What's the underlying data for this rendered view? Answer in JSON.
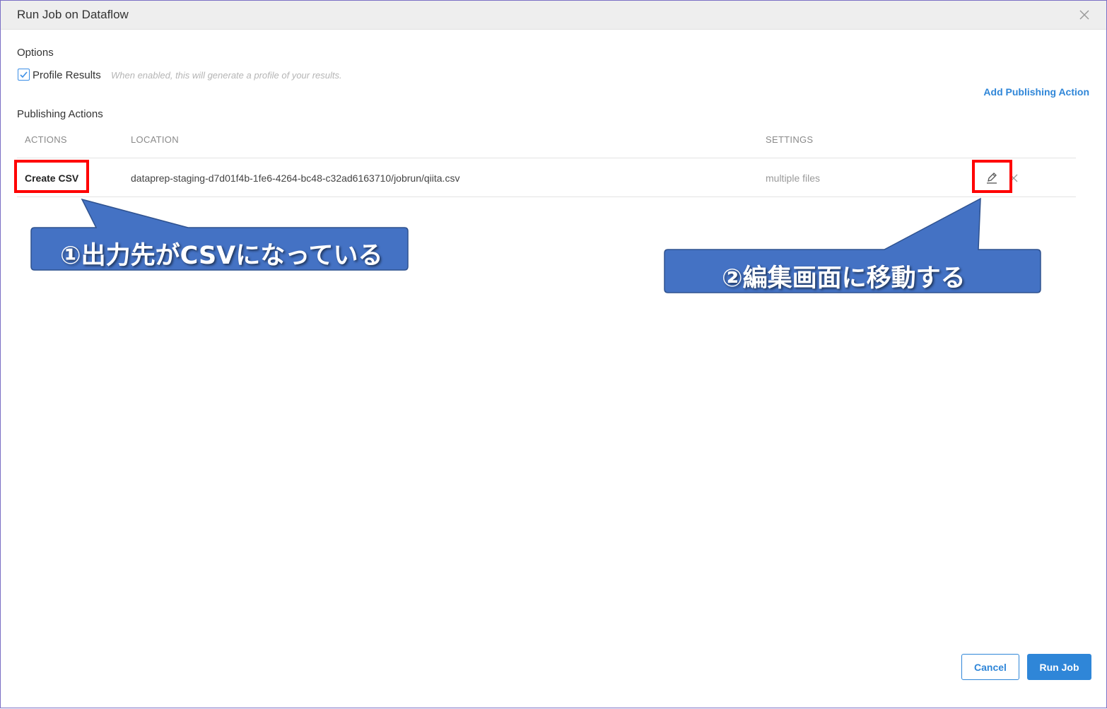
{
  "window": {
    "title": "Run Job on Dataflow"
  },
  "options": {
    "label": "Options",
    "profile_results": {
      "label": "Profile Results",
      "checked": true,
      "hint": "When enabled, this will generate a profile of your results."
    }
  },
  "publishing": {
    "label": "Publishing Actions",
    "add_action_label": "Add Publishing Action",
    "columns": {
      "actions": "ACTIONS",
      "location": "LOCATION",
      "settings": "SETTINGS"
    },
    "rows": [
      {
        "action": "Create CSV",
        "location": "dataprep-staging-d7d01f4b-1fe6-4264-bc48-c32ad6163710/jobrun/qiita.csv",
        "settings": "multiple files"
      }
    ]
  },
  "annotations": {
    "callout1": "①出力先がCSVになっている",
    "callout2": "②編集画面に移動する"
  },
  "footer": {
    "cancel_label": "Cancel",
    "run_label": "Run Job"
  },
  "colors": {
    "accent": "#2f86d8",
    "callout_fill": "#4472c4",
    "highlight": "#ff0000"
  },
  "icons": [
    "close-icon",
    "check-icon",
    "pencil-icon",
    "remove-icon"
  ]
}
